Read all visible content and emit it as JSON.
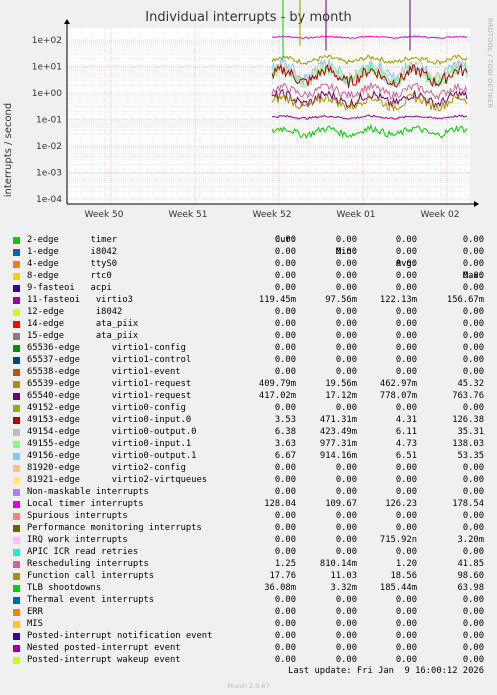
{
  "title": "Individual interrupts - by month",
  "watermark": "RRDTOOL / TOBI OETIKER",
  "footer": "Munin 2.0.67",
  "last_update": "Last update: Fri Jan  9 16:00:12 2026",
  "legend_headers": {
    "cur": "Cur:",
    "min": "Min:",
    "avg": "Avg:",
    "max": "Max:"
  },
  "chart_data": {
    "type": "line",
    "title": "Individual interrupts - by month",
    "ylabel": "interrupts / second",
    "y_scale": "log",
    "ylim": [
      0.0001,
      100
    ],
    "y_ticks": [
      "1e+02",
      "1e+01",
      "1e+00",
      "1e-01",
      "1e-02",
      "1e-03",
      "1e-04"
    ],
    "x_ticks": [
      "Week 50",
      "Week 51",
      "Week 52",
      "Week 01",
      "Week 02"
    ],
    "grid": true,
    "series": [
      {
        "name": "2-edge      timer",
        "color": "#00cc00",
        "cur": "0.00",
        "min": "0.00",
        "avg": "0.00",
        "max": "0.00"
      },
      {
        "name": "1-edge      i8042",
        "color": "#0066b3",
        "cur": "0.00",
        "min": "0.00",
        "avg": "0.00",
        "max": "0.00"
      },
      {
        "name": "4-edge      ttyS0",
        "color": "#ff8000",
        "cur": "0.00",
        "min": "0.00",
        "avg": "0.00",
        "max": "0.00"
      },
      {
        "name": "8-edge      rtc0",
        "color": "#ffcc00",
        "cur": "0.00",
        "min": "0.00",
        "avg": "0.00",
        "max": "0.00"
      },
      {
        "name": "9-fasteoi   acpi",
        "color": "#330099",
        "cur": "0.00",
        "min": "0.00",
        "avg": "0.00",
        "max": "0.00"
      },
      {
        "name": "11-fasteoi   virtio3",
        "color": "#990099",
        "cur": "119.45m",
        "min": "97.56m",
        "avg": "122.13m",
        "max": "156.67m"
      },
      {
        "name": "12-edge      i8042",
        "color": "#ccff00",
        "cur": "0.00",
        "min": "0.00",
        "avg": "0.00",
        "max": "0.00"
      },
      {
        "name": "14-edge      ata_piix",
        "color": "#ff0000",
        "cur": "0.00",
        "min": "0.00",
        "avg": "0.00",
        "max": "0.00"
      },
      {
        "name": "15-edge      ata_piix",
        "color": "#808080",
        "cur": "0.00",
        "min": "0.00",
        "avg": "0.00",
        "max": "0.00"
      },
      {
        "name": "65536-edge      virtio1-config",
        "color": "#008f00",
        "cur": "0.00",
        "min": "0.00",
        "avg": "0.00",
        "max": "0.00"
      },
      {
        "name": "65537-edge      virtio1-control",
        "color": "#00487d",
        "cur": "0.00",
        "min": "0.00",
        "avg": "0.00",
        "max": "0.00"
      },
      {
        "name": "65538-edge      virtio1-event",
        "color": "#b35a00",
        "cur": "0.00",
        "min": "0.00",
        "avg": "0.00",
        "max": "0.00"
      },
      {
        "name": "65539-edge      virtio1-request",
        "color": "#b38f00",
        "cur": "409.79m",
        "min": "19.56m",
        "avg": "462.97m",
        "max": "45.32"
      },
      {
        "name": "65540-edge      virtio1-request",
        "color": "#6b006b",
        "cur": "417.02m",
        "min": "17.12m",
        "avg": "778.07m",
        "max": "763.76"
      },
      {
        "name": "49152-edge      virtio0-config",
        "color": "#8fb300",
        "cur": "0.00",
        "min": "0.00",
        "avg": "0.00",
        "max": "0.00"
      },
      {
        "name": "49153-edge      virtio0-input.0",
        "color": "#b30000",
        "cur": "3.53",
        "min": "471.31m",
        "avg": "4.31",
        "max": "126.38"
      },
      {
        "name": "49154-edge      virtio0-output.0",
        "color": "#bebebe",
        "cur": "6.38",
        "min": "423.49m",
        "avg": "6.11",
        "max": "35.31"
      },
      {
        "name": "49155-edge      virtio0-input.1",
        "color": "#80ff80",
        "cur": "3.63",
        "min": "977.31m",
        "avg": "4.73",
        "max": "138.03"
      },
      {
        "name": "49156-edge      virtio0-output.1",
        "color": "#80c9ff",
        "cur": "6.67",
        "min": "914.16m",
        "avg": "6.51",
        "max": "53.35"
      },
      {
        "name": "81920-edge      virtio2-config",
        "color": "#ffc080",
        "cur": "0.00",
        "min": "0.00",
        "avg": "0.00",
        "max": "0.00"
      },
      {
        "name": "81921-edge      virtio2-virtqueues",
        "color": "#ffe680",
        "cur": "0.00",
        "min": "0.00",
        "avg": "0.00",
        "max": "0.00"
      },
      {
        "name": "Non-maskable interrupts",
        "color": "#aa80ff",
        "cur": "0.00",
        "min": "0.00",
        "avg": "0.00",
        "max": "0.00"
      },
      {
        "name": "Local timer interrupts",
        "color": "#ee00cc",
        "cur": "128.04",
        "min": "109.67",
        "avg": "126.23",
        "max": "178.54"
      },
      {
        "name": "Spurious interrupts",
        "color": "#ff8080",
        "cur": "0.00",
        "min": "0.00",
        "avg": "0.00",
        "max": "0.00"
      },
      {
        "name": "Performance monitoring interrupts",
        "color": "#666600",
        "cur": "0.00",
        "min": "0.00",
        "avg": "0.00",
        "max": "0.00"
      },
      {
        "name": "IRQ work interrupts",
        "color": "#ffbfff",
        "cur": "0.00",
        "min": "0.00",
        "avg": "715.92n",
        "max": "3.20m"
      },
      {
        "name": "APIC ICR read retries",
        "color": "#00ffcc",
        "cur": "0.00",
        "min": "0.00",
        "avg": "0.00",
        "max": "0.00"
      },
      {
        "name": "Rescheduling interrupts",
        "color": "#cc6699",
        "cur": "1.25",
        "min": "810.14m",
        "avg": "1.20",
        "max": "41.85"
      },
      {
        "name": "Function call interrupts",
        "color": "#999900",
        "cur": "17.76",
        "min": "11.03",
        "avg": "18.56",
        "max": "98.60"
      },
      {
        "name": "TLB shootdowns",
        "color": "#00cc00",
        "cur": "36.08m",
        "min": "3.32m",
        "avg": "185.44m",
        "max": "63.98"
      },
      {
        "name": "Thermal event interrupts",
        "color": "#0066b3",
        "cur": "0.00",
        "min": "0.00",
        "avg": "0.00",
        "max": "0.00"
      },
      {
        "name": "ERR",
        "color": "#ff8000",
        "cur": "0.00",
        "min": "0.00",
        "avg": "0.00",
        "max": "0.00"
      },
      {
        "name": "MIS",
        "color": "#ffcc00",
        "cur": "0.00",
        "min": "0.00",
        "avg": "0.00",
        "max": "0.00"
      },
      {
        "name": "Posted-interrupt notification event",
        "color": "#330099",
        "cur": "0.00",
        "min": "0.00",
        "avg": "0.00",
        "max": "0.00"
      },
      {
        "name": "Nested posted-interrupt event",
        "color": "#990099",
        "cur": "0.00",
        "min": "0.00",
        "avg": "0.00",
        "max": "0.00"
      },
      {
        "name": "Posted-interrupt wakeup event",
        "color": "#ccff00",
        "cur": "0.00",
        "min": "0.00",
        "avg": "0.00",
        "max": "0.00"
      }
    ],
    "traces": [
      {
        "label": "Local timer interrupts",
        "color": "#ee00cc",
        "level": 128,
        "jitter": 0.05
      },
      {
        "label": "Function call interrupts",
        "color": "#999900",
        "level": 18,
        "jitter": 0.18
      },
      {
        "label": "49156-edge      virtio0-output.1",
        "color": "#80c9ff",
        "level": 6.5,
        "jitter": 0.55
      },
      {
        "label": "49154-edge      virtio0-output.0",
        "color": "#bebebe",
        "level": 6.1,
        "jitter": 0.5
      },
      {
        "label": "49155-edge      virtio0-input.1",
        "color": "#80ff80",
        "level": 4.7,
        "jitter": 0.5
      },
      {
        "label": "49153-edge      virtio0-input.0",
        "color": "#b30000",
        "level": 4.3,
        "jitter": 0.45
      },
      {
        "label": "Rescheduling interrupts",
        "color": "#cc6699",
        "level": 1.2,
        "jitter": 0.3
      },
      {
        "label": "65540-edge      virtio1-request",
        "color": "#6b006b",
        "level": 0.6,
        "jitter": 0.35
      },
      {
        "label": "65539-edge      virtio1-request",
        "color": "#b38f00",
        "level": 0.45,
        "jitter": 0.35
      },
      {
        "label": "11-fasteoi   virtio3",
        "color": "#990099",
        "level": 0.122,
        "jitter": 0.08
      },
      {
        "label": "TLB shootdowns",
        "color": "#00cc00",
        "level": 0.035,
        "jitter": 0.25
      }
    ],
    "data_start": "Week 52"
  }
}
